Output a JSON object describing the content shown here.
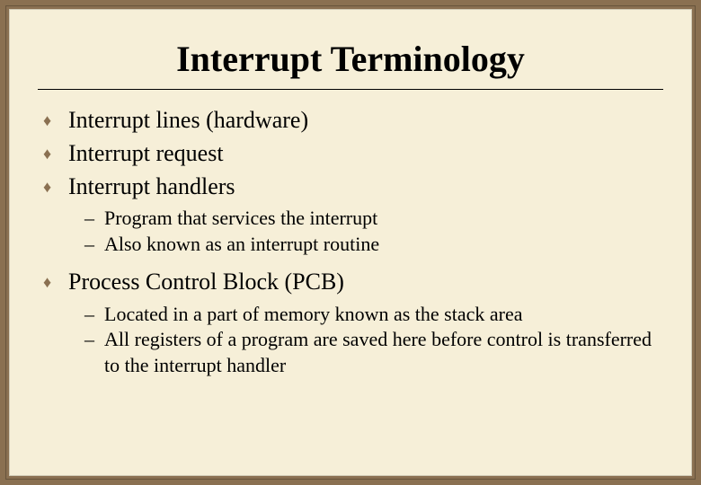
{
  "title": "Interrupt Terminology",
  "items": {
    "i0": {
      "text": "Interrupt lines (hardware)"
    },
    "i1": {
      "text": "Interrupt request"
    },
    "i2": {
      "text": "Interrupt handlers",
      "sub": {
        "s0": "Program that services the interrupt",
        "s1": "Also known as an interrupt routine"
      }
    },
    "i3": {
      "text": "Process Control Block (PCB)",
      "sub": {
        "s0": "Located in a part of memory known as the stack area",
        "s1": "All registers of a program are saved here before control is transferred to the interrupt handler"
      }
    }
  }
}
